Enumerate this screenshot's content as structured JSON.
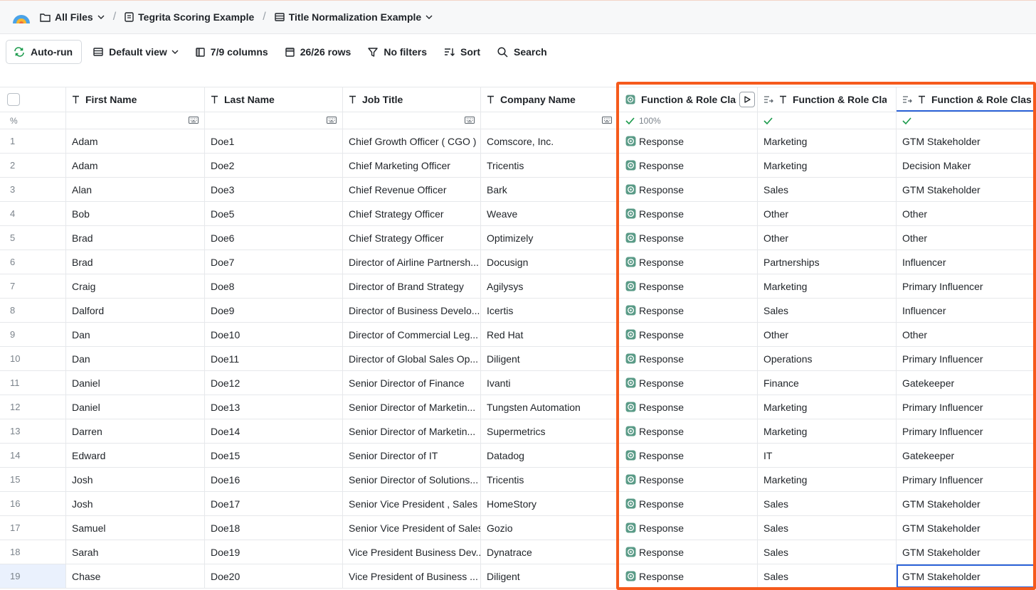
{
  "breadcrumb": {
    "all_files": "All Files",
    "workbook": "Tegrita Scoring Example",
    "table": "Title Normalization Example"
  },
  "toolbar": {
    "autorun": "Auto-run",
    "view": "Default view",
    "columns": "7/9 columns",
    "rows": "26/26 rows",
    "filters": "No filters",
    "sort": "Sort",
    "search": "Search"
  },
  "columns": {
    "first_name": "First Name",
    "last_name": "Last Name",
    "job_title": "Job Title",
    "company_name": "Company Name",
    "fn_role_1": "Function & Role Classification",
    "fn_role_2": "Function & Role Classification",
    "fn_role_3": "Function & Role Classification"
  },
  "subheader": {
    "row_label": "%",
    "progress": "100%"
  },
  "accent_colors": {
    "highlight": "#f55a1c",
    "success": "#1a9a4b",
    "autorun": "#1a9a4b",
    "selection": "#2d63d8"
  },
  "rows": [
    {
      "n": "1",
      "first": "Adam",
      "last": "Doe1",
      "title": "Chief Growth Officer ( CGO )",
      "company": "Comscore, Inc.",
      "resp": "Response",
      "function": "Marketing",
      "role": "GTM Stakeholder"
    },
    {
      "n": "2",
      "first": "Adam",
      "last": "Doe2",
      "title": "Chief Marketing Officer",
      "company": "Tricentis",
      "resp": "Response",
      "function": "Marketing",
      "role": "Decision Maker"
    },
    {
      "n": "3",
      "first": "Alan",
      "last": "Doe3",
      "title": "Chief Revenue Officer",
      "company": "Bark",
      "resp": "Response",
      "function": "Sales",
      "role": "GTM Stakeholder"
    },
    {
      "n": "4",
      "first": "Bob",
      "last": "Doe5",
      "title": "Chief Strategy Officer",
      "company": "Weave",
      "resp": "Response",
      "function": "Other",
      "role": "Other"
    },
    {
      "n": "5",
      "first": "Brad",
      "last": "Doe6",
      "title": "Chief Strategy Officer",
      "company": "Optimizely",
      "resp": "Response",
      "function": "Other",
      "role": "Other"
    },
    {
      "n": "6",
      "first": "Brad",
      "last": "Doe7",
      "title": "Director of Airline Partnersh...",
      "company": "Docusign",
      "resp": "Response",
      "function": "Partnerships",
      "role": "Influencer"
    },
    {
      "n": "7",
      "first": "Craig",
      "last": "Doe8",
      "title": "Director of Brand Strategy",
      "company": "Agilysys",
      "resp": "Response",
      "function": "Marketing",
      "role": "Primary Influencer"
    },
    {
      "n": "8",
      "first": "Dalford",
      "last": "Doe9",
      "title": "Director of Business Develo...",
      "company": "Icertis",
      "resp": "Response",
      "function": "Sales",
      "role": "Influencer"
    },
    {
      "n": "9",
      "first": "Dan",
      "last": "Doe10",
      "title": "Director of Commercial Leg...",
      "company": "Red Hat",
      "resp": "Response",
      "function": "Other",
      "role": "Other"
    },
    {
      "n": "10",
      "first": "Dan",
      "last": "Doe11",
      "title": "Director of Global Sales Op...",
      "company": "Diligent",
      "resp": "Response",
      "function": "Operations",
      "role": "Primary Influencer"
    },
    {
      "n": "11",
      "first": "Daniel",
      "last": "Doe12",
      "title": "Senior Director of Finance",
      "company": "Ivanti",
      "resp": "Response",
      "function": "Finance",
      "role": "Gatekeeper"
    },
    {
      "n": "12",
      "first": "Daniel",
      "last": "Doe13",
      "title": "Senior Director of Marketin...",
      "company": "Tungsten Automation",
      "resp": "Response",
      "function": "Marketing",
      "role": "Primary Influencer"
    },
    {
      "n": "13",
      "first": "Darren",
      "last": "Doe14",
      "title": "Senior Director of Marketin...",
      "company": "Supermetrics",
      "resp": "Response",
      "function": "Marketing",
      "role": "Primary Influencer"
    },
    {
      "n": "14",
      "first": "Edward",
      "last": "Doe15",
      "title": "Senior Director of IT",
      "company": "Datadog",
      "resp": "Response",
      "function": "IT",
      "role": "Gatekeeper"
    },
    {
      "n": "15",
      "first": "Josh",
      "last": "Doe16",
      "title": "Senior Director of Solutions...",
      "company": "Tricentis",
      "resp": "Response",
      "function": "Marketing",
      "role": "Primary Influencer"
    },
    {
      "n": "16",
      "first": "Josh",
      "last": "Doe17",
      "title": "Senior Vice President , Sales",
      "company": "HomeStory",
      "resp": "Response",
      "function": "Sales",
      "role": "GTM Stakeholder"
    },
    {
      "n": "17",
      "first": "Samuel",
      "last": "Doe18",
      "title": "Senior Vice President of Sales",
      "company": "Gozio",
      "resp": "Response",
      "function": "Sales",
      "role": "GTM Stakeholder"
    },
    {
      "n": "18",
      "first": "Sarah",
      "last": "Doe19",
      "title": "Vice President Business Dev...",
      "company": "Dynatrace",
      "resp": "Response",
      "function": "Sales",
      "role": "GTM Stakeholder"
    },
    {
      "n": "19",
      "first": "Chase",
      "last": "Doe20",
      "title": "Vice President of Business ...",
      "company": "Diligent",
      "resp": "Response",
      "function": "Sales",
      "role": "GTM Stakeholder"
    }
  ]
}
